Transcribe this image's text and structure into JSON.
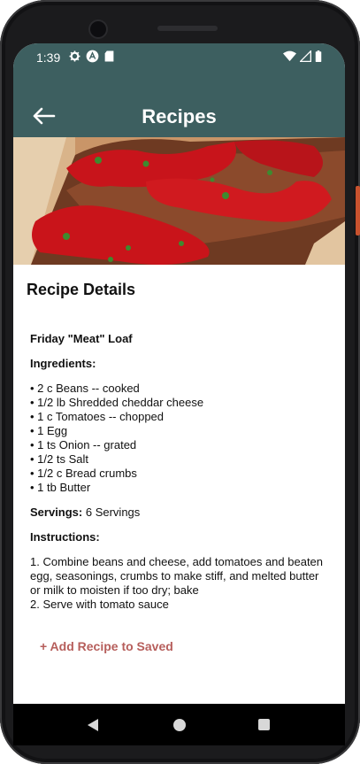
{
  "status_bar": {
    "time": "1:39"
  },
  "app_bar": {
    "title": "Recipes",
    "back_icon": "arrow-left-icon"
  },
  "hero_image": {
    "description_icon": "meatloaf-photo"
  },
  "details": {
    "section_title": "Recipe Details",
    "recipe_name": "Friday \"Meat\" Loaf",
    "ingredients_label": "Ingredients:",
    "ingredients": [
      "• 2 c Beans -- cooked",
      "• 1/2 lb Shredded cheddar cheese",
      "• 1 c Tomatoes -- chopped",
      "• 1 Egg",
      "• 1 ts Onion -- grated",
      "• 1/2 ts Salt",
      "• 1/2 c Bread crumbs",
      "• 1 tb Butter"
    ],
    "servings_label": "Servings:",
    "servings_value": " 6 Servings",
    "instructions_label": "Instructions:",
    "instructions": [
      "1. Combine beans and cheese, add tomatoes and beaten egg, seasonings, crumbs to make stiff, and melted butter or milk to moisten if too dry; bake",
      "2. Serve with tomato sauce"
    ]
  },
  "actions": {
    "add_label": "+ Add Recipe to Saved"
  },
  "colors": {
    "app_bar": "#3d5f60",
    "accent": "#b65e5b"
  }
}
